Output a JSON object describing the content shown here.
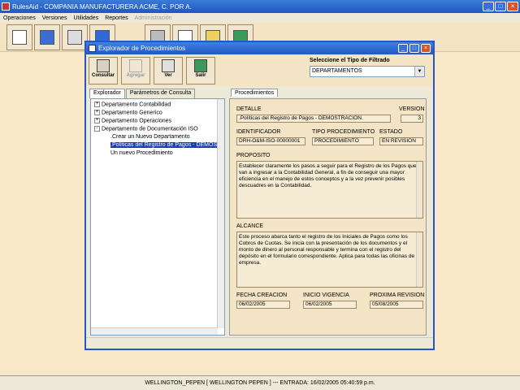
{
  "app": {
    "title": "RulesAid - COMPANIA MANUFACTURERA ACME, C. POR A.",
    "menu": [
      "Operaciones",
      "Versiones",
      "Utilidades",
      "Reportes",
      "Administración"
    ],
    "toolbar_icons": [
      "document-icon",
      "notes-icon",
      "key-icon",
      "mobile-icon",
      "gear-icon",
      "ballot-icon",
      "pencil-icon",
      "exit-icon"
    ],
    "status": "WELLINGTON_PEPEN [ WELLINGTON PEPEN ] --- ENTRADA: 16/02/2005 05:40:59 p.m."
  },
  "dialog": {
    "title": "Explorador de Procedimientos",
    "actions": [
      {
        "label": "Consultar",
        "icon": "query-icon",
        "enabled": true
      },
      {
        "label": "Agregar",
        "icon": "add-icon",
        "enabled": false
      },
      {
        "label": "Ver",
        "icon": "view-icon",
        "enabled": true
      },
      {
        "label": "Salir",
        "icon": "exit-icon",
        "enabled": true
      }
    ],
    "filter": {
      "label": "Seleccione el Tipo de Filtrado",
      "value": "DEPARTAMENTOS"
    },
    "left_tabs": [
      "Explorador",
      "Parámetros de Consulta"
    ],
    "tree": [
      {
        "label": "Departamento Contabilidad",
        "toggle": "+"
      },
      {
        "label": "Departamento Generico",
        "toggle": "+"
      },
      {
        "label": "Departamento Operaciones",
        "toggle": "+"
      },
      {
        "label": "Departamento de Documentación ISO",
        "toggle": "-"
      },
      {
        "label": ".Crear un Nuevo Departamento"
      },
      {
        "label": ".Políticas del Registro de Pagos - DEMOST"
      },
      {
        "label": "Un nuevo Procedimiento"
      }
    ],
    "right_tab": "Procedimientos",
    "detail": {
      "detalle_label": "DETALLE",
      "detalle": ".Políticas del Registro de Pagos - DEMOSTRACION.",
      "version_label": "VERSION",
      "version": "3",
      "id_label": "IDENTIFICADOR",
      "id": "DRH-O&M-ISO-00000001",
      "tipo_label": "TIPO PROCEDIMIENTO",
      "tipo": "PROCEDIMIENTO",
      "estado_label": "ESTADO",
      "estado": "EN REVISION",
      "proposito_label": "PROPOSITO",
      "proposito": "Establecer claramente los pasos a seguir para el Registro de los Pagos que van a ingresar a la Contabilidad General, a fin de conseguir una mayor eficiencia en el manejo de estos conceptos y a la vez prevenir posibles descuadres en la Contabilidad.",
      "alcance_label": "ALCANCE",
      "alcance": "Este proceso abarca tanto el registro de los Iniciales de Pagos como los Cobros de Cuotas. Se inicia con la presentación de los documentos y el monto de dinero al personal responsable y termina con el registro del depósito en el formulario correspondiente. Aplica para todas las oficinas de la empresa.",
      "creacion_label": "FECHA CREACION",
      "creacion": "06/02/2005",
      "vigencia_label": "INICIO VIGENCIA",
      "vigencia": "06/02/2005",
      "revision_label": "PROXIMA REVISION",
      "revision": "05/08/2005"
    }
  }
}
